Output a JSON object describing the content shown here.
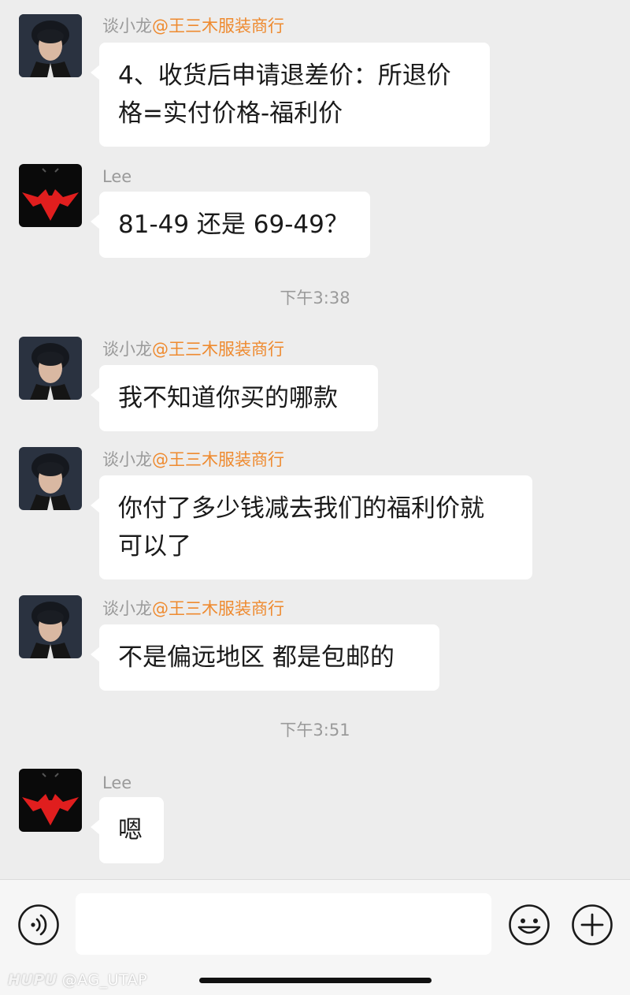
{
  "messages": [
    {
      "sender": "谈小龙",
      "mention": "@王三木服装商行",
      "lines": [
        "4、收货后申请退差价：所退价",
        "格=实付价格-福利价"
      ]
    },
    {
      "sender": "Lee",
      "mention": "",
      "lines": [
        "81-49 还是 69-49？"
      ]
    },
    {
      "sender": "谈小龙",
      "mention": "@王三木服装商行",
      "lines": [
        "我不知道你买的哪款"
      ]
    },
    {
      "sender": "谈小龙",
      "mention": "@王三木服装商行",
      "lines": [
        "你付了多少钱减去我们的福利价就",
        "可以了"
      ]
    },
    {
      "sender": "谈小龙",
      "mention": "@王三木服装商行",
      "lines": [
        "不是偏远地区 都是包邮的"
      ]
    },
    {
      "sender": "Lee",
      "mention": "",
      "lines": [
        "嗯"
      ]
    }
  ],
  "timestamps": [
    "下午3:38",
    "下午3:51"
  ],
  "input": {
    "value": "",
    "placeholder": ""
  },
  "icons": {
    "voice": "voice-icon",
    "emoji": "emoji-icon",
    "plus": "plus-icon"
  },
  "watermark": {
    "logo": "HUPU",
    "handle": "@AG_UTAP"
  },
  "colors": {
    "background": "#ededed",
    "bubble": "#ffffff",
    "mention": "#ee8a2f",
    "sender": "#9a9a9a",
    "lee_avatar_bat": "#e01e1e"
  }
}
